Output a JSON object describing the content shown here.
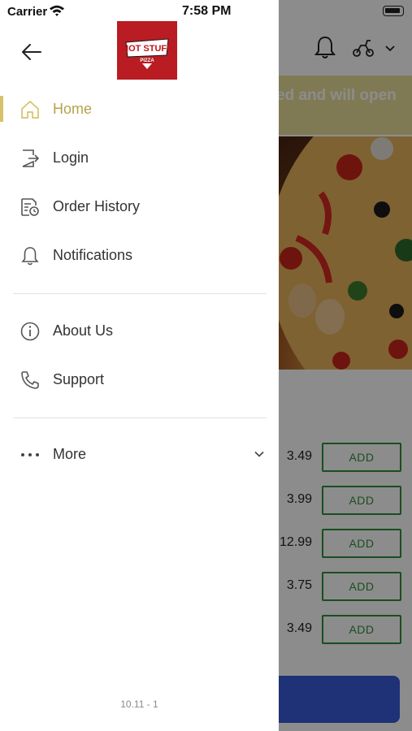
{
  "status_bar": {
    "carrier": "Carrier",
    "time": "7:58 PM"
  },
  "background_page": {
    "banner_text": "ed and will open",
    "products": [
      {
        "price": "3.49",
        "add_label": "ADD"
      },
      {
        "price": "3.99",
        "add_label": "ADD"
      },
      {
        "price": "12.99",
        "add_label": "ADD"
      },
      {
        "price": "3.75",
        "add_label": "ADD"
      },
      {
        "price": "3.49",
        "add_label": "ADD"
      }
    ]
  },
  "drawer": {
    "logo_text": "HOT STUFF",
    "logo_subtext": "PIZZA",
    "menu_primary": [
      {
        "label": "Home",
        "icon": "home-icon",
        "active": true
      },
      {
        "label": "Login",
        "icon": "login-icon",
        "active": false
      },
      {
        "label": "Order History",
        "icon": "order-history-icon",
        "active": false
      },
      {
        "label": "Notifications",
        "icon": "bell-icon",
        "active": false
      }
    ],
    "menu_secondary": [
      {
        "label": "About Us",
        "icon": "info-icon"
      },
      {
        "label": "Support",
        "icon": "phone-icon"
      }
    ],
    "more": {
      "label": "More",
      "icon": "more-dots-icon"
    },
    "version": "10.11 - 1"
  },
  "colors": {
    "accent": "#d7c26b",
    "active_text": "#b8a24a",
    "add_button": "#2f8f3a",
    "cart_bar": "#3a5bd9",
    "logo_bg": "#b91c22"
  }
}
